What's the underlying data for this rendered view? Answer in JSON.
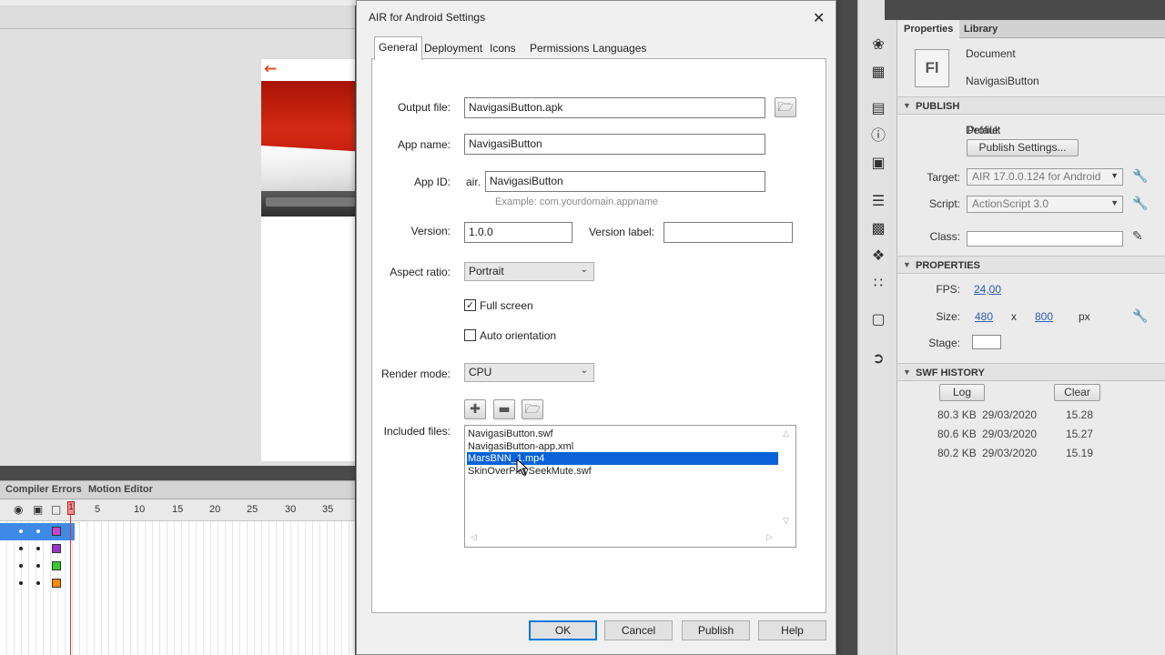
{
  "dialog": {
    "title": "AIR for Android Settings",
    "tabs": [
      "General",
      "Deployment",
      "Icons",
      "Permissions",
      "Languages"
    ],
    "output_file_label": "Output file:",
    "output_file_value": "NavigasiButton.apk",
    "app_name_label": "App name:",
    "app_name_value": "NavigasiButton",
    "app_id_label": "App ID:",
    "app_id_prefix": "air.",
    "app_id_value": "NavigasiButton",
    "app_id_hint": "Example: com.yourdomain.appname",
    "version_label": "Version:",
    "version_value": "1.0.0",
    "version_label_label": "Version label:",
    "version_label_value": "",
    "aspect_ratio_label": "Aspect ratio:",
    "aspect_ratio_value": "Portrait",
    "full_screen_label": "Full screen",
    "full_screen_checked": true,
    "auto_orientation_label": "Auto orientation",
    "auto_orientation_checked": false,
    "render_mode_label": "Render mode:",
    "render_mode_value": "CPU",
    "included_files_label": "Included files:",
    "included_files": [
      "NavigasiButton.swf",
      "NavigasiButton-app.xml",
      "MarsBNN_1.mp4",
      "SkinOverPlaySeekMute.swf"
    ],
    "selected_file_index": 2,
    "buttons": {
      "ok": "OK",
      "cancel": "Cancel",
      "publish": "Publish",
      "help": "Help"
    }
  },
  "timeline": {
    "tabs": [
      "Compiler Errors",
      "Motion Editor"
    ],
    "frame_numbers": [
      "1",
      "5",
      "10",
      "15",
      "20",
      "25",
      "30",
      "35"
    ],
    "layer_colors": [
      "#cc44cc",
      "#9933cc",
      "#33cc33",
      "#ff8800"
    ]
  },
  "properties": {
    "tabs": [
      "Properties",
      "Library"
    ],
    "doc_type": "Document",
    "doc_icon_text": "Fl",
    "doc_name": "NavigasiButton",
    "publish_section": "PUBLISH",
    "profile_label": "Profile:",
    "profile_value": "Default",
    "publish_settings_button": "Publish Settings...",
    "target_label": "Target:",
    "target_value": "AIR 17.0.0.124 for Android",
    "script_label": "Script:",
    "script_value": "ActionScript 3.0",
    "class_label": "Class:",
    "properties_section": "PROPERTIES",
    "fps_label": "FPS:",
    "fps_value": "24,00",
    "size_label": "Size:",
    "size_w": "480",
    "size_x": "x",
    "size_h": "800",
    "size_unit": "px",
    "stage_label": "Stage:",
    "stage_color": "#ffffff",
    "swf_history_section": "SWF HISTORY",
    "log_button": "Log",
    "clear_button": "Clear",
    "history": [
      {
        "size": "80.3 KB",
        "date": "29/03/2020",
        "time": "15.28"
      },
      {
        "size": "80.6 KB",
        "date": "29/03/2020",
        "time": "15.27"
      },
      {
        "size": "80.2 KB",
        "date": "29/03/2020",
        "time": "15.19"
      }
    ]
  },
  "colors": {
    "selection": "#0a62d6",
    "default_button_border": "#0078d7",
    "flag_red": "#c62010",
    "link_blue": "#2a5db0"
  },
  "icons": {
    "back": "left-arrow-icon",
    "browse": "folder-icon",
    "add": "plus-icon",
    "remove": "minus-icon",
    "add_folder": "folder-add-icon"
  }
}
